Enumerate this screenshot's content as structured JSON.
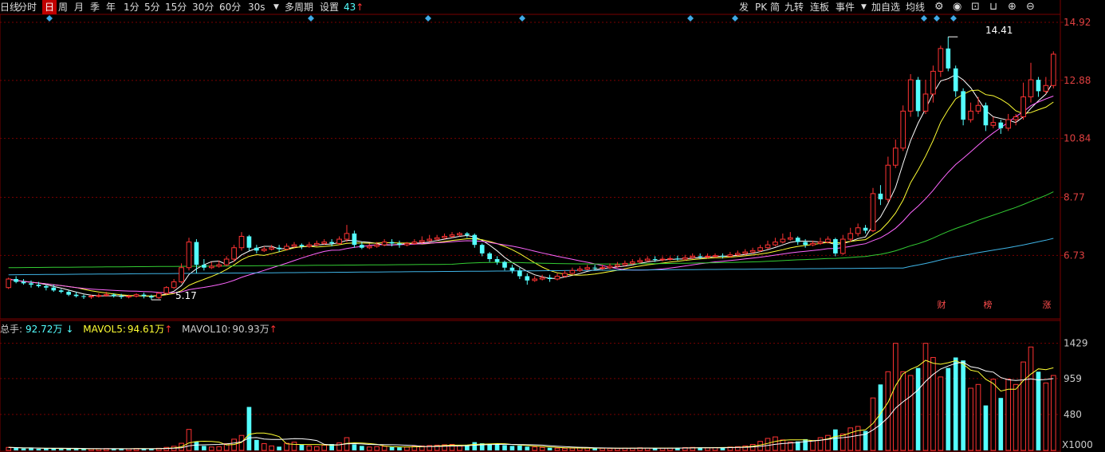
{
  "toolbar": {
    "left_items": [
      "日线",
      "分时",
      "日",
      "周",
      "月",
      "季",
      "年",
      "1分",
      "5分",
      "15分",
      "30分",
      "60分",
      "30s",
      "多周期",
      "设置",
      "43"
    ],
    "active_item": "日",
    "right_items": [
      "发",
      "PK",
      "简",
      "九转",
      "连板",
      "事件",
      "加自选",
      "均线"
    ],
    "right_icons": [
      "settings-icon",
      "eye-icon",
      "lock-icon",
      "lock-open-icon",
      "zoom-in-icon",
      "zoom-out-icon"
    ]
  },
  "colors": {
    "background": "#000000",
    "up": "#ff3333",
    "down": "#54ffff",
    "ma5": "#ffffff",
    "ma10": "#ffff33",
    "ma20": "#ff66ff",
    "ma60": "#33cc33",
    "ma120": "#3fb4e6",
    "grid": "#7a0000",
    "axis_text": "#e04040"
  },
  "price_panel": {
    "y_ticks": [
      "14.92",
      "12.88",
      "10.84",
      "8.77",
      "6.73"
    ],
    "high_marker": "14.41",
    "low_marker": "5.17",
    "badges": [
      "财",
      "榜",
      "涨"
    ]
  },
  "volume_panel": {
    "legend": {
      "total_label": "总手:",
      "total_value": "92.72万",
      "total_arrow": "↓",
      "mavol5_label": "MAVOL5:",
      "mavol5_value": "94.61万",
      "mavol5_arrow": "↑",
      "mavol10_label": "MAVOL10:",
      "mavol10_value": "90.93万",
      "mavol10_arrow": "↑"
    },
    "y_ticks": [
      "1429",
      "959",
      "480"
    ],
    "unit": "X1000"
  },
  "chart_data": {
    "type": "candlestick",
    "price_axis": {
      "min": 4.5,
      "max": 15.2
    },
    "volume_axis": {
      "min": 0,
      "max": 1500
    },
    "candles": [
      [
        5.6,
        5.9,
        5.55,
        5.95
      ],
      [
        5.9,
        5.8,
        5.75,
        6.0
      ],
      [
        5.8,
        5.75,
        5.7,
        5.9
      ],
      [
        5.75,
        5.7,
        5.6,
        5.85
      ],
      [
        5.7,
        5.65,
        5.6,
        5.8
      ],
      [
        5.65,
        5.6,
        5.5,
        5.7
      ],
      [
        5.6,
        5.5,
        5.45,
        5.7
      ],
      [
        5.5,
        5.45,
        5.4,
        5.55
      ],
      [
        5.45,
        5.35,
        5.3,
        5.5
      ],
      [
        5.35,
        5.3,
        5.25,
        5.45
      ],
      [
        5.3,
        5.28,
        5.2,
        5.35
      ],
      [
        5.28,
        5.3,
        5.2,
        5.35
      ],
      [
        5.3,
        5.32,
        5.25,
        5.4
      ],
      [
        5.32,
        5.35,
        5.28,
        5.45
      ],
      [
        5.35,
        5.3,
        5.25,
        5.4
      ],
      [
        5.3,
        5.28,
        5.2,
        5.38
      ],
      [
        5.28,
        5.3,
        5.22,
        5.35
      ],
      [
        5.3,
        5.35,
        5.25,
        5.4
      ],
      [
        5.35,
        5.3,
        5.22,
        5.42
      ],
      [
        5.3,
        5.25,
        5.17,
        5.35
      ],
      [
        5.25,
        5.4,
        5.2,
        5.45
      ],
      [
        5.4,
        5.6,
        5.35,
        5.65
      ],
      [
        5.6,
        5.8,
        5.55,
        5.9
      ],
      [
        5.8,
        6.3,
        5.75,
        6.45
      ],
      [
        6.3,
        7.2,
        6.2,
        7.35
      ],
      [
        7.2,
        6.4,
        6.1,
        7.3
      ],
      [
        6.4,
        6.3,
        6.2,
        6.6
      ],
      [
        6.3,
        6.35,
        6.25,
        6.5
      ],
      [
        6.35,
        6.4,
        6.3,
        6.55
      ],
      [
        6.4,
        6.6,
        6.35,
        6.7
      ],
      [
        6.6,
        7.0,
        6.5,
        7.1
      ],
      [
        7.0,
        7.4,
        6.9,
        7.55
      ],
      [
        7.4,
        7.0,
        6.9,
        7.45
      ],
      [
        7.0,
        6.9,
        6.8,
        7.1
      ],
      [
        6.9,
        6.95,
        6.85,
        7.05
      ],
      [
        6.95,
        7.0,
        6.9,
        7.1
      ],
      [
        7.0,
        6.95,
        6.85,
        7.1
      ],
      [
        6.95,
        7.05,
        6.9,
        7.15
      ],
      [
        7.05,
        7.1,
        7.0,
        7.2
      ],
      [
        7.1,
        7.05,
        6.95,
        7.15
      ],
      [
        7.05,
        7.1,
        7.0,
        7.2
      ],
      [
        7.1,
        7.15,
        7.05,
        7.25
      ],
      [
        7.15,
        7.2,
        7.1,
        7.3
      ],
      [
        7.2,
        7.15,
        7.05,
        7.3
      ],
      [
        7.15,
        7.3,
        7.1,
        7.4
      ],
      [
        7.3,
        7.5,
        7.2,
        7.8
      ],
      [
        7.5,
        7.1,
        7.0,
        7.6
      ],
      [
        7.1,
        7.0,
        6.95,
        7.2
      ],
      [
        7.0,
        7.05,
        6.95,
        7.15
      ],
      [
        7.05,
        7.1,
        7.0,
        7.2
      ],
      [
        7.1,
        7.2,
        7.05,
        7.3
      ],
      [
        7.2,
        7.15,
        7.05,
        7.3
      ],
      [
        7.15,
        7.1,
        7.0,
        7.25
      ],
      [
        7.1,
        7.15,
        7.05,
        7.2
      ],
      [
        7.15,
        7.2,
        7.1,
        7.3
      ],
      [
        7.2,
        7.25,
        7.15,
        7.4
      ],
      [
        7.25,
        7.3,
        7.2,
        7.45
      ],
      [
        7.3,
        7.35,
        7.25,
        7.45
      ],
      [
        7.35,
        7.4,
        7.3,
        7.5
      ],
      [
        7.4,
        7.45,
        7.35,
        7.55
      ],
      [
        7.45,
        7.5,
        7.4,
        7.55
      ],
      [
        7.5,
        7.45,
        7.35,
        7.55
      ],
      [
        7.45,
        7.1,
        7.0,
        7.5
      ],
      [
        7.1,
        6.8,
        6.7,
        7.15
      ],
      [
        6.8,
        6.6,
        6.5,
        6.85
      ],
      [
        6.6,
        6.5,
        6.4,
        6.7
      ],
      [
        6.5,
        6.3,
        6.2,
        6.55
      ],
      [
        6.3,
        6.2,
        6.1,
        6.4
      ],
      [
        6.2,
        6.0,
        5.9,
        6.3
      ],
      [
        6.0,
        5.85,
        5.7,
        6.1
      ],
      [
        5.85,
        5.9,
        5.8,
        6.0
      ],
      [
        5.9,
        5.95,
        5.85,
        6.05
      ],
      [
        5.95,
        5.9,
        5.8,
        6.05
      ],
      [
        5.9,
        6.0,
        5.85,
        6.1
      ],
      [
        6.0,
        6.1,
        5.95,
        6.2
      ],
      [
        6.1,
        6.2,
        6.05,
        6.3
      ],
      [
        6.2,
        6.25,
        6.15,
        6.35
      ],
      [
        6.25,
        6.3,
        6.2,
        6.4
      ],
      [
        6.3,
        6.28,
        6.2,
        6.4
      ],
      [
        6.28,
        6.3,
        6.22,
        6.4
      ],
      [
        6.3,
        6.35,
        6.25,
        6.45
      ],
      [
        6.35,
        6.4,
        6.3,
        6.5
      ],
      [
        6.4,
        6.45,
        6.35,
        6.55
      ],
      [
        6.45,
        6.5,
        6.4,
        6.6
      ],
      [
        6.5,
        6.55,
        6.45,
        6.65
      ],
      [
        6.55,
        6.6,
        6.5,
        6.7
      ],
      [
        6.6,
        6.58,
        6.5,
        6.7
      ],
      [
        6.58,
        6.6,
        6.52,
        6.7
      ],
      [
        6.6,
        6.62,
        6.55,
        6.7
      ],
      [
        6.62,
        6.6,
        6.55,
        6.72
      ],
      [
        6.6,
        6.65,
        6.55,
        6.75
      ],
      [
        6.65,
        6.7,
        6.6,
        6.8
      ],
      [
        6.7,
        6.68,
        6.6,
        6.8
      ],
      [
        6.68,
        6.7,
        6.62,
        6.8
      ],
      [
        6.7,
        6.72,
        6.65,
        6.8
      ],
      [
        6.72,
        6.7,
        6.62,
        6.8
      ],
      [
        6.7,
        6.75,
        6.65,
        6.85
      ],
      [
        6.75,
        6.8,
        6.7,
        6.9
      ],
      [
        6.8,
        6.85,
        6.75,
        6.95
      ],
      [
        6.85,
        6.9,
        6.8,
        7.0
      ],
      [
        6.9,
        7.0,
        6.85,
        7.1
      ],
      [
        7.0,
        7.1,
        6.95,
        7.25
      ],
      [
        7.1,
        7.2,
        7.05,
        7.35
      ],
      [
        7.2,
        7.3,
        7.15,
        7.5
      ],
      [
        7.3,
        7.35,
        7.25,
        7.55
      ],
      [
        7.35,
        7.2,
        7.1,
        7.4
      ],
      [
        7.2,
        7.1,
        7.0,
        7.3
      ],
      [
        7.1,
        7.15,
        7.05,
        7.25
      ],
      [
        7.15,
        7.2,
        7.1,
        7.35
      ],
      [
        7.2,
        7.3,
        7.15,
        7.4
      ],
      [
        7.3,
        6.8,
        6.7,
        7.35
      ],
      [
        6.8,
        7.3,
        6.75,
        7.45
      ],
      [
        7.3,
        7.5,
        7.2,
        7.7
      ],
      [
        7.5,
        7.7,
        7.4,
        7.85
      ],
      [
        7.7,
        7.6,
        7.5,
        7.8
      ],
      [
        7.6,
        8.9,
        7.55,
        9.1
      ],
      [
        8.9,
        8.7,
        8.5,
        9.2
      ],
      [
        8.7,
        9.9,
        8.6,
        10.2
      ],
      [
        9.9,
        10.5,
        9.8,
        10.8
      ],
      [
        10.5,
        11.8,
        10.4,
        12.0
      ],
      [
        11.8,
        12.9,
        11.6,
        13.1
      ],
      [
        12.9,
        11.8,
        11.6,
        13.0
      ],
      [
        11.8,
        12.4,
        11.7,
        12.9
      ],
      [
        12.4,
        13.2,
        12.1,
        13.4
      ],
      [
        13.2,
        14.0,
        13.0,
        14.1
      ],
      [
        14.0,
        13.3,
        13.2,
        14.41
      ],
      [
        13.3,
        12.5,
        12.3,
        13.4
      ],
      [
        12.5,
        11.5,
        11.3,
        12.6
      ],
      [
        11.5,
        11.8,
        11.4,
        12.1
      ],
      [
        11.8,
        12.0,
        11.7,
        12.3
      ],
      [
        12.0,
        11.3,
        11.1,
        12.1
      ],
      [
        11.3,
        11.4,
        11.2,
        11.6
      ],
      [
        11.4,
        11.2,
        11.0,
        11.5
      ],
      [
        11.2,
        11.5,
        11.1,
        11.7
      ],
      [
        11.5,
        11.6,
        11.3,
        11.7
      ],
      [
        11.6,
        12.3,
        11.5,
        12.8
      ],
      [
        12.3,
        12.9,
        12.1,
        13.5
      ],
      [
        12.9,
        12.5,
        12.3,
        13.0
      ],
      [
        12.5,
        12.7,
        12.4,
        13.0
      ],
      [
        12.7,
        13.8,
        12.6,
        13.9
      ]
    ],
    "volumes": [
      40,
      35,
      25,
      30,
      22,
      28,
      26,
      20,
      24,
      22,
      18,
      20,
      22,
      25,
      24,
      20,
      22,
      26,
      24,
      20,
      28,
      40,
      55,
      95,
      280,
      120,
      60,
      45,
      50,
      90,
      150,
      200,
      580,
      140,
      90,
      60,
      50,
      95,
      110,
      80,
      60,
      50,
      70,
      85,
      100,
      170,
      80,
      60,
      45,
      50,
      55,
      45,
      40,
      45,
      55,
      60,
      65,
      70,
      75,
      80,
      60,
      75,
      110,
      95,
      90,
      80,
      70,
      60,
      65,
      50,
      45,
      40,
      35,
      30,
      28,
      30,
      35,
      32,
      30,
      28,
      26,
      28,
      30,
      32,
      35,
      30,
      28,
      30,
      32,
      35,
      38,
      40,
      36,
      34,
      38,
      42,
      45,
      50,
      60,
      80,
      120,
      160,
      180,
      140,
      110,
      120,
      150,
      130,
      170,
      200,
      280,
      220,
      300,
      320,
      260,
      700,
      880,
      1050,
      1429,
      1050,
      1000,
      1100,
      1429,
      1240,
      980,
      1100,
      1240,
      1200,
      830,
      880,
      600,
      950,
      700,
      950,
      880,
      1180,
      1380,
      1050,
      900,
      1000
    ],
    "ma_series": [
      "MA5",
      "MA10",
      "MA20",
      "MA60",
      "MA120"
    ]
  }
}
